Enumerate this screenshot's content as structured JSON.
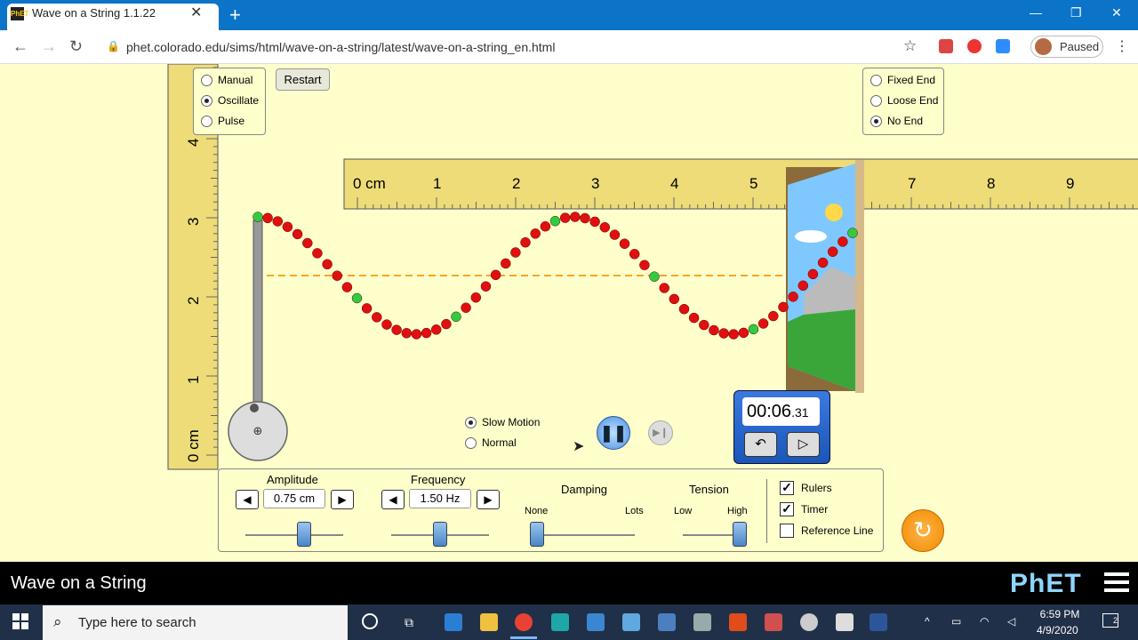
{
  "browser": {
    "tab_title": "Wave on a String 1.1.22",
    "tab_favicon": "PhET",
    "url": "phet.colorado.edu/sims/html/wave-on-a-string/latest/wave-on-a-string_en.html",
    "profile_label": "Paused",
    "icons": [
      "back-icon",
      "forward-icon",
      "reload-icon",
      "lock-icon",
      "star-icon",
      "menu-dots-icon"
    ]
  },
  "sim": {
    "mode_options": [
      {
        "label": "Manual",
        "selected": false
      },
      {
        "label": "Oscillate",
        "selected": true
      },
      {
        "label": "Pulse",
        "selected": false
      }
    ],
    "restart_label": "Restart",
    "end_options": [
      {
        "label": "Fixed End",
        "selected": false
      },
      {
        "label": "Loose End",
        "selected": false
      },
      {
        "label": "No End",
        "selected": true
      }
    ],
    "horizontal_ruler": {
      "first_label": "0 cm",
      "labels": [
        "1",
        "2",
        "3",
        "4",
        "5",
        "7",
        "8",
        "9"
      ]
    },
    "vertical_ruler": {
      "first_label": "0 cm",
      "labels": [
        "1",
        "2",
        "3",
        "4"
      ]
    },
    "speed_options": [
      {
        "label": "Slow Motion",
        "selected": true
      },
      {
        "label": "Normal",
        "selected": false
      }
    ],
    "timer": {
      "main": "00:06",
      "fraction": ".31"
    },
    "amplitude": {
      "label": "Amplitude",
      "value": "0.75 cm",
      "slider_fraction": 0.6
    },
    "frequency": {
      "label": "Frequency",
      "value": "1.50 Hz",
      "slider_fraction": 0.5
    },
    "damping": {
      "label": "Damping",
      "min_label": "None",
      "max_label": "Lots",
      "slider_fraction": 0.0
    },
    "tension": {
      "label": "Tension",
      "min_label": "Low",
      "max_label": "High",
      "slider_fraction": 1.0
    },
    "checkboxes": [
      {
        "label": "Rulers",
        "checked": true
      },
      {
        "label": "Timer",
        "checked": true
      },
      {
        "label": "Reference Line",
        "checked": false
      }
    ]
  },
  "footer": {
    "title": "Wave on a String",
    "logo": "PhET"
  },
  "taskbar": {
    "search_placeholder": "Type here to search",
    "time": "6:59 PM",
    "date": "4/9/2020",
    "notification_count": "2"
  }
}
